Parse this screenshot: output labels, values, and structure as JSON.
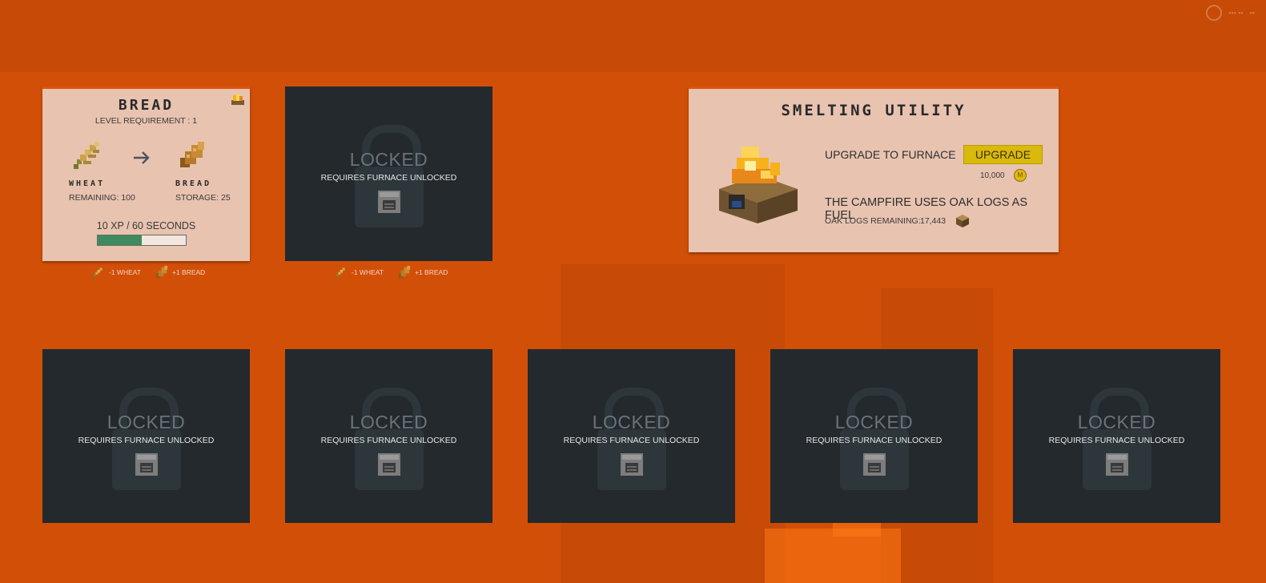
{
  "recipe_card": {
    "title": "BREAD",
    "level_requirement": "LEVEL REQUIREMENT : 1",
    "input_name": "WHEAT",
    "input_remaining": "REMAINING: 100",
    "output_name": "BREAD",
    "output_storage": "STORAGE: 25",
    "xp_text": "10 XP / 60 SECONDS",
    "progress_fraction": 0.5
  },
  "cost_row": {
    "consume": "-1 WHEAT",
    "produce": "+1 BREAD"
  },
  "locked_slot": {
    "title": "LOCKED",
    "subtitle": "REQUIRES FURNACE UNLOCKED"
  },
  "utility": {
    "title": "SMELTING UTILITY",
    "upgrade_text": "UPGRADE TO FURNACE",
    "upgrade_button": "UPGRADE",
    "upgrade_cost": "10,000",
    "coin_letter": "M",
    "fuel_text": "THE CAMPFIRE USES OAK LOGS AS FUEL",
    "logs_label": "OAK LOGS REMAINING:",
    "logs_value": "17,443"
  },
  "colors": {
    "background": "#d24f08",
    "card": "#e8c3b0",
    "locked": "#23292d",
    "progress": "#3f8a5e",
    "button": "#d9b90c"
  },
  "icons": [
    "campfire-icon",
    "wheat-icon",
    "bread-icon",
    "arrow-right-icon",
    "furnace-icon",
    "lock-icon",
    "coin-icon",
    "oak-log-icon"
  ]
}
